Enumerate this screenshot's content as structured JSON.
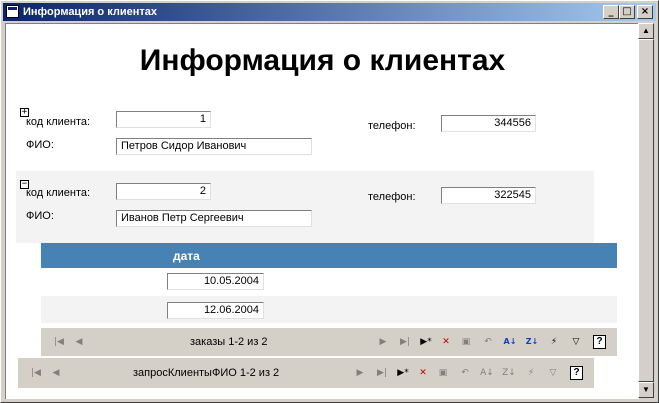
{
  "window": {
    "title": "Информация о клиентах",
    "minimize_glyph": "_",
    "maximize_glyph": "□",
    "close_glyph": "×"
  },
  "report": {
    "heading": "Информация о клиентах"
  },
  "records": [
    {
      "expander": "+",
      "client_code_label": "код клиента:",
      "client_code": "1",
      "fio_label": "ФИО:",
      "fio": "Петров  Сидор  Иванович",
      "phone_label": "телефон:",
      "phone": "344556"
    },
    {
      "expander": "−",
      "client_code_label": "код клиента:",
      "client_code": "2",
      "fio_label": "ФИО:",
      "fio": "Иванов  Петр  Сергеевич",
      "phone_label": "телефон:",
      "phone": "322545"
    }
  ],
  "subform": {
    "column_header": "дата",
    "rows": [
      "10.05.2004",
      "12.06.2004"
    ],
    "nav_text": "заказы 1-2 из 2"
  },
  "main_nav": {
    "nav_text": "запросКлиентыФИО 1-2 из 2"
  },
  "nav_icons": {
    "first": "first-record-icon",
    "prev": "previous-record-icon",
    "next": "next-record-icon",
    "last": "last-record-icon",
    "new": "new-record-icon",
    "delete": "delete-record-icon",
    "save": "save-record-icon",
    "undo": "undo-icon",
    "sort_asc": "sort-ascending-icon",
    "sort_desc": "sort-descending-icon",
    "filter_selection": "filter-by-selection-icon",
    "toggle_filter": "toggle-filter-icon",
    "help": "help-icon"
  },
  "colors": {
    "title_bar_start": "#0a246a",
    "title_bar_end": "#a6caf0",
    "subform_header": "#4682b4",
    "band": "#f3f3f3",
    "nav_bar": "#d4d0c8"
  }
}
